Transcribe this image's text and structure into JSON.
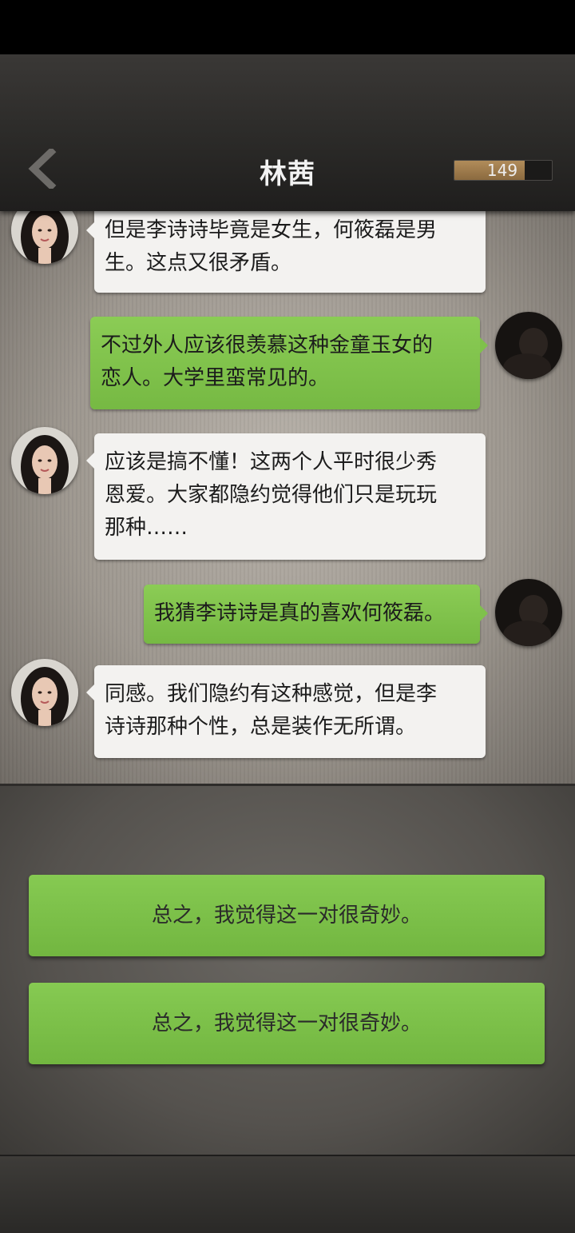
{
  "header": {
    "title": "林茜",
    "energy_value": "149",
    "energy_fraction": 0.72
  },
  "messages": [
    {
      "side": "left",
      "lines": [
        "但是李诗诗毕竟是女生，何筱磊是男",
        "生。这点又很矛盾。"
      ]
    },
    {
      "side": "right",
      "lines": [
        "不过外人应该很羡慕这种金童玉女的",
        "恋人。大学里蛮常见的。"
      ]
    },
    {
      "side": "left",
      "lines": [
        "应该是搞不懂！这两个人平时很少秀",
        "恩爱。大家都隐约觉得他们只是玩玩",
        "那种……"
      ]
    },
    {
      "side": "right",
      "lines": [
        "我猜李诗诗是真的喜欢何筱磊。"
      ]
    },
    {
      "side": "left",
      "lines": [
        "同感。我们隐约有这种感觉，但是李",
        "诗诗那种个性，总是装作无所谓。"
      ]
    }
  ],
  "choices": [
    {
      "label": "总之，我觉得这一对很奇妙。"
    },
    {
      "label": "总之，我觉得这一对很奇妙。"
    }
  ],
  "colors": {
    "player_bubble": "#82c64e",
    "npc_bubble": "#f3f2f0",
    "energy_fill": "#a98553"
  }
}
